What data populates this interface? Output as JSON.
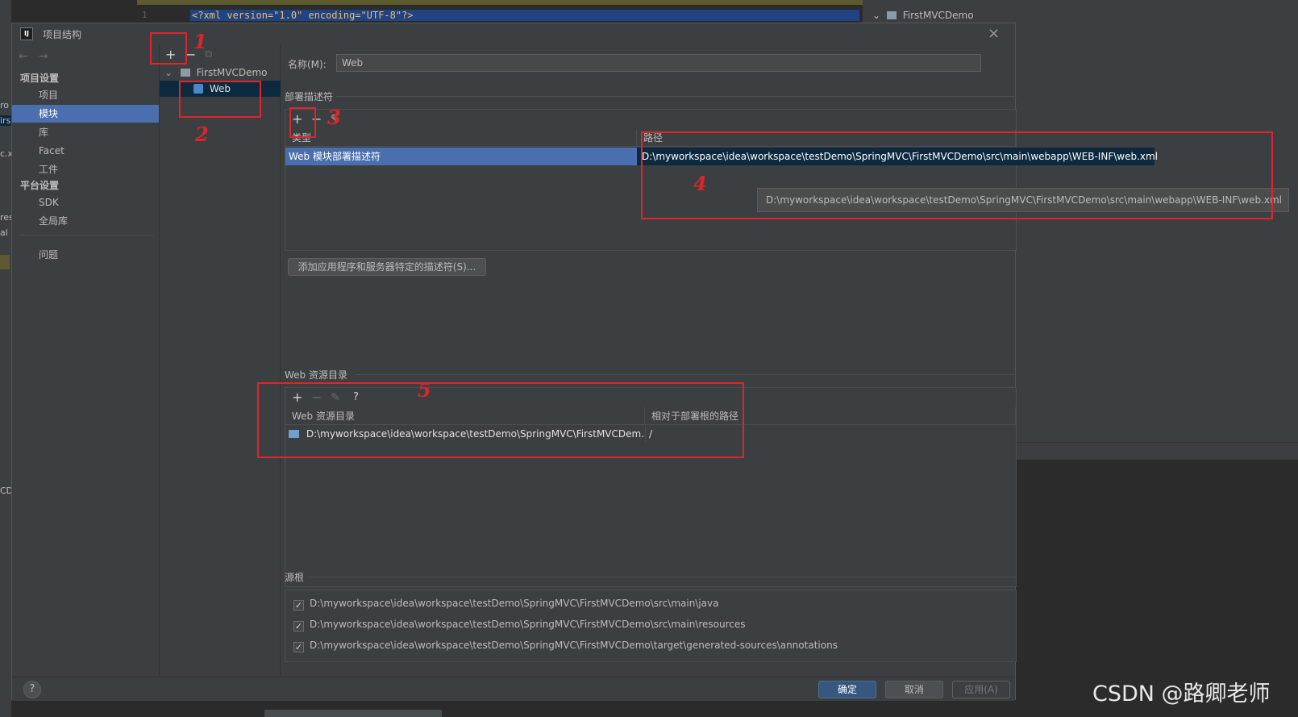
{
  "background": {
    "line_number": "1",
    "code_line": "<?xml version=\"1.0\" encoding=\"UTF-8\"?>",
    "right_tree_item": "FirstMVCDemo",
    "left_fragments": [
      "ro",
      "irs",
      "c.x",
      "res",
      "al",
      "CD"
    ]
  },
  "dialog": {
    "title": "项目结构",
    "app_icon_text": "IJ",
    "close_icon": "×"
  },
  "nav": {
    "back_arrow": "←",
    "forward_arrow": "→",
    "project_settings_header": "项目设置",
    "items_project": [
      "项目",
      "模块",
      "库",
      "Facet",
      "工件"
    ],
    "platform_settings_header": "平台设置",
    "items_platform": [
      "SDK",
      "全局库"
    ],
    "problems": "问题",
    "selected": "模块"
  },
  "modules": {
    "add": "+",
    "remove": "−",
    "copy": "⧉",
    "tree_root": "FirstMVCDemo",
    "tree_child": "Web"
  },
  "facet": {
    "name_label": "名称(M):",
    "name_value": "Web",
    "deployment_title": "部署描述符",
    "deploy_toolbar": {
      "add": "+",
      "remove": "−",
      "edit": "✎"
    },
    "deploy_headers": [
      "类型",
      "路径"
    ],
    "deploy_row_type": "Web 模块部署描述符",
    "deploy_row_path": "D:\\myworkspace\\idea\\workspace\\testDemo\\SpringMVC\\FirstMVCDemo\\src\\main\\webapp\\WEB-INF\\web.xml",
    "tooltip": "D:\\myworkspace\\idea\\workspace\\testDemo\\SpringMVC\\FirstMVCDemo\\src\\main\\webapp\\WEB-INF\\web.xml",
    "add_server_descriptor_button": "添加应用程序和服务器特定的描述符(S)...",
    "web_resource_title": "Web 资源目录",
    "web_toolbar": {
      "add": "+",
      "remove": "−",
      "edit": "✎",
      "help": "?"
    },
    "web_headers": [
      "Web 资源目录",
      "相对于部署根的路径"
    ],
    "web_row_dir": "D:\\myworkspace\\idea\\workspace\\testDemo\\SpringMVC\\FirstMVCDem...",
    "web_row_rel": "/",
    "source_roots_title": "源根",
    "source_roots": [
      "D:\\myworkspace\\idea\\workspace\\testDemo\\SpringMVC\\FirstMVCDemo\\src\\main\\java",
      "D:\\myworkspace\\idea\\workspace\\testDemo\\SpringMVC\\FirstMVCDemo\\src\\main\\resources",
      "D:\\myworkspace\\idea\\workspace\\testDemo\\SpringMVC\\FirstMVCDemo\\target\\generated-sources\\annotations"
    ]
  },
  "footer": {
    "help": "?",
    "ok": "确定",
    "cancel": "取消",
    "apply": "应用(A)"
  },
  "annotations": [
    "1",
    "2",
    "3",
    "4",
    "5"
  ],
  "watermark": "CSDN @路卿老师",
  "colors": {
    "selection": "#4b6eaf",
    "annotation_red": "#e0242b",
    "panel": "#3c3f41"
  }
}
